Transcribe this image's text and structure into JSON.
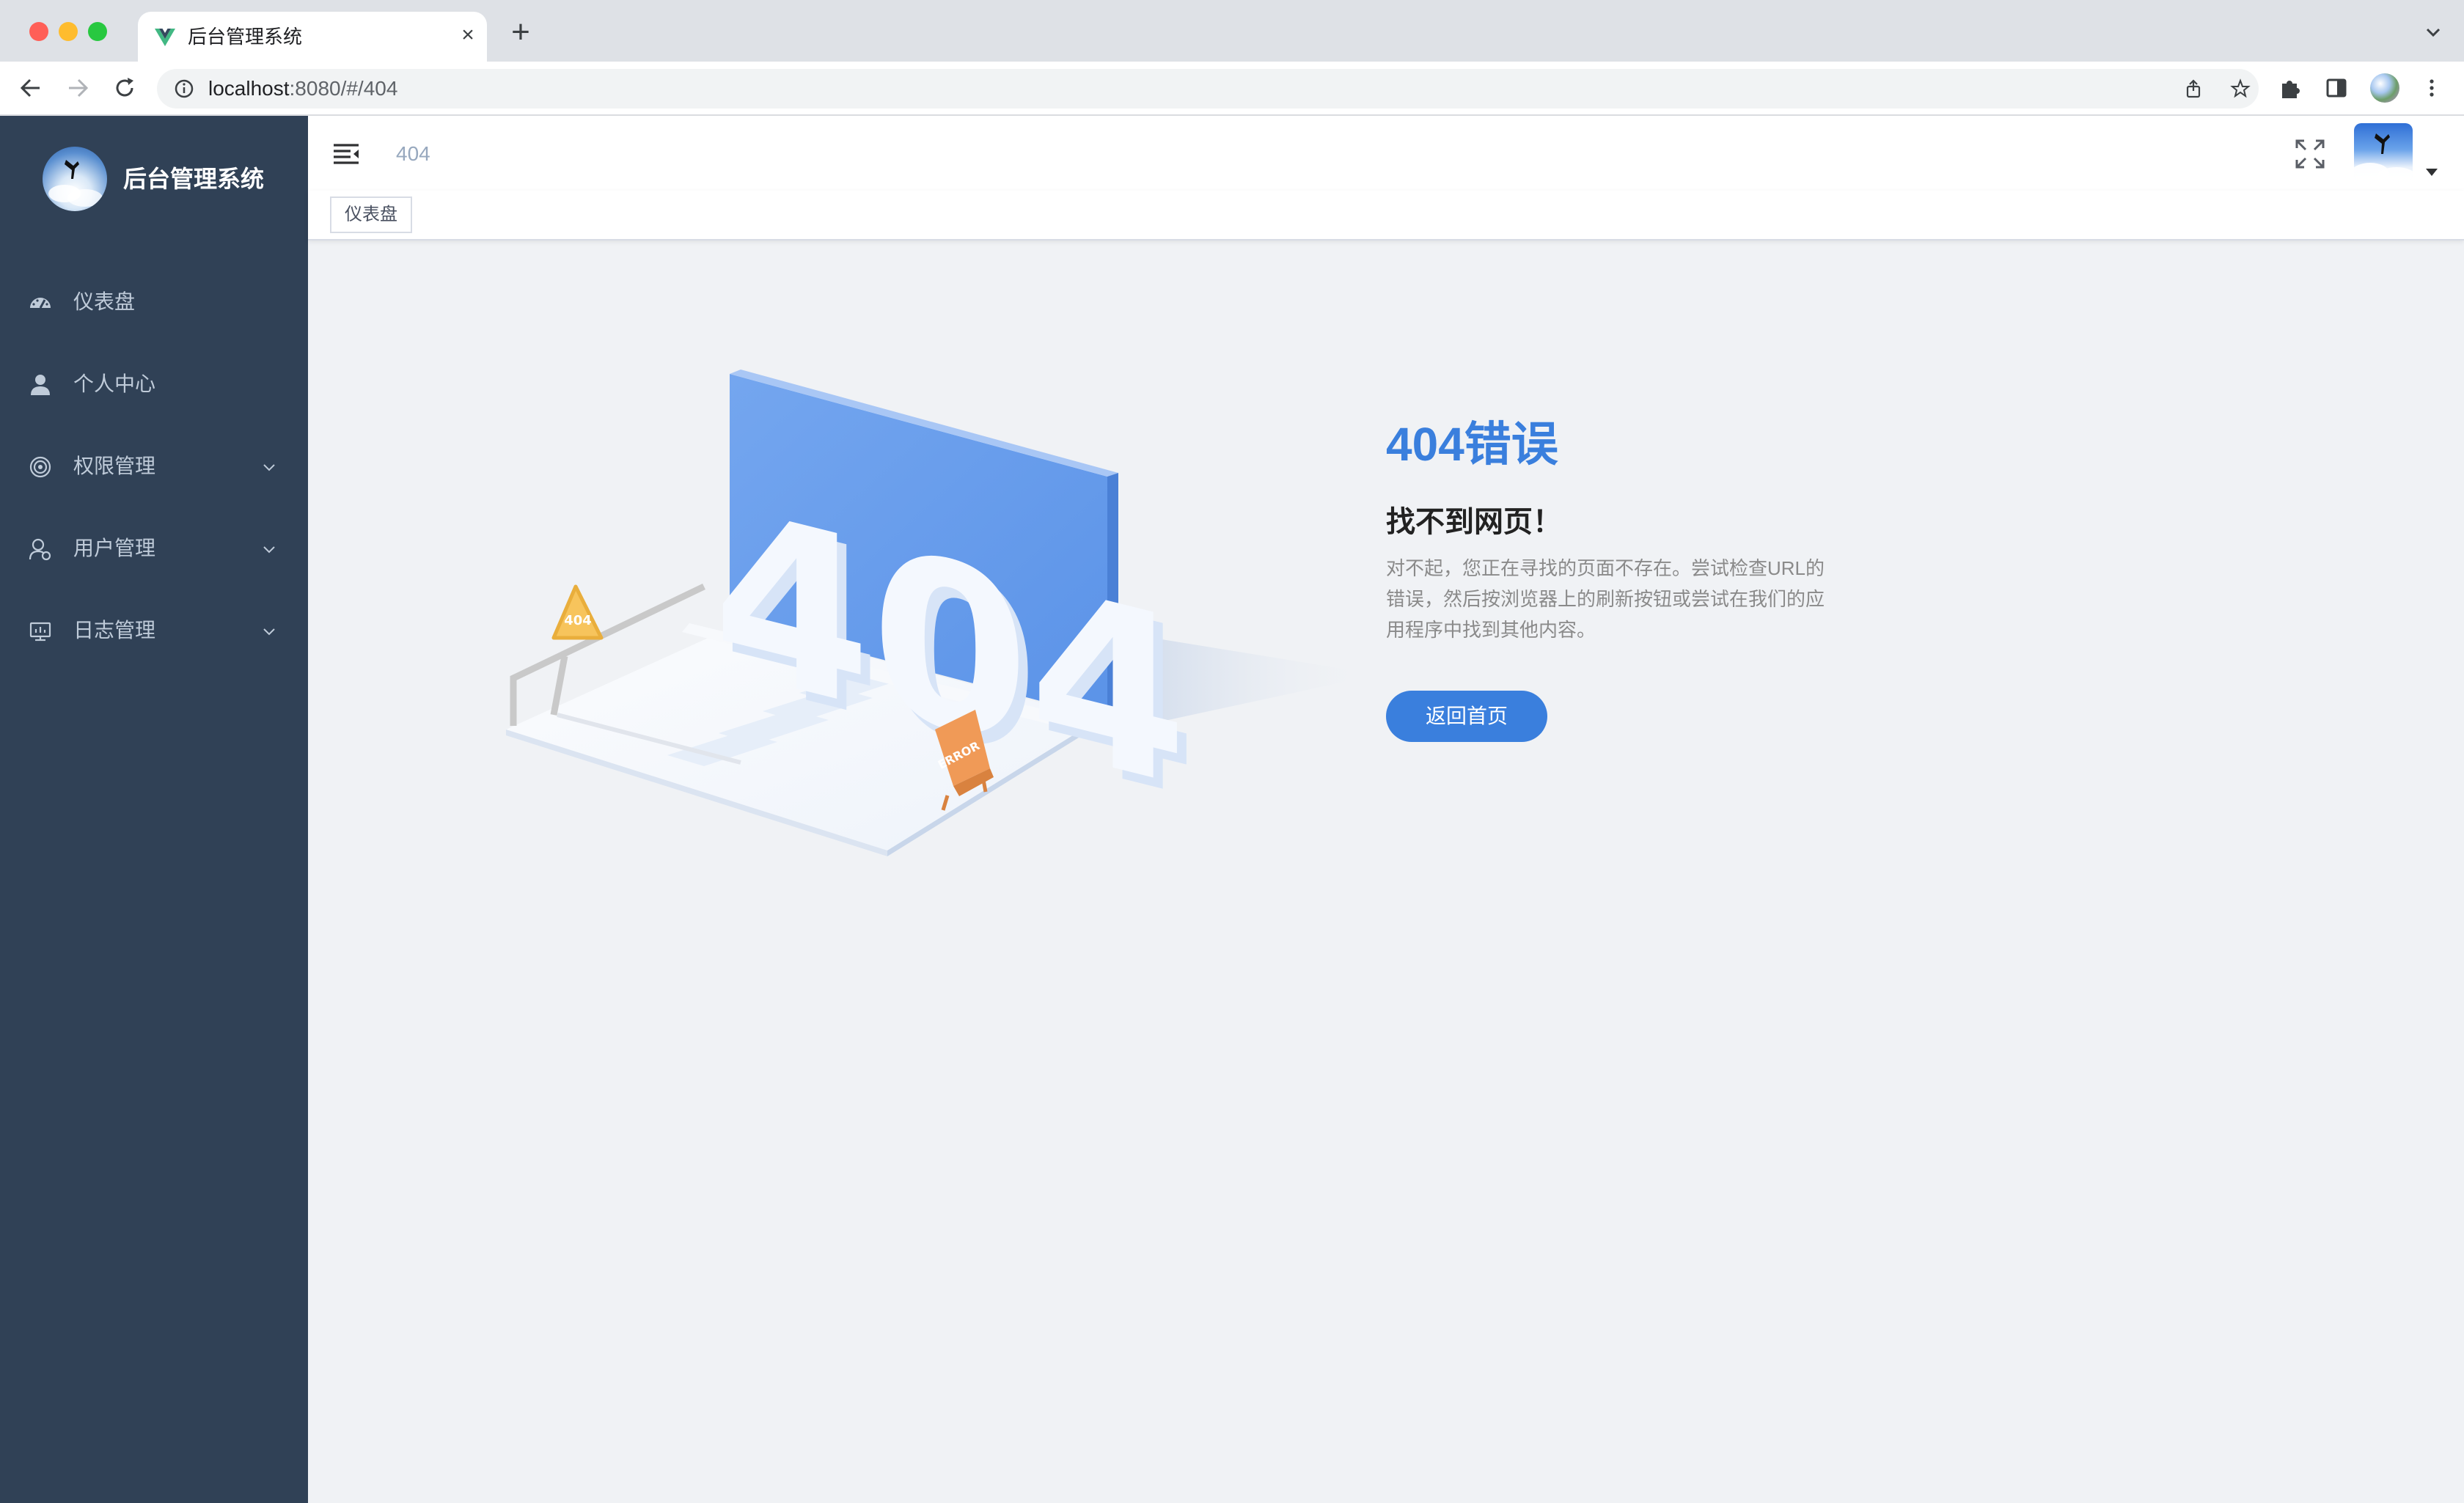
{
  "browser": {
    "tab_title": "后台管理系统",
    "tab_close": "×",
    "new_tab": "+",
    "url_host": "localhost",
    "url_path": ":8080/#/404"
  },
  "sidebar": {
    "title": "后台管理系统",
    "items": [
      {
        "label": "仪表盘",
        "icon": "dashboard-icon",
        "has_submenu": false
      },
      {
        "label": "个人中心",
        "icon": "user-icon",
        "has_submenu": false
      },
      {
        "label": "权限管理",
        "icon": "permission-icon",
        "has_submenu": true
      },
      {
        "label": "用户管理",
        "icon": "user-management-icon",
        "has_submenu": true
      },
      {
        "label": "日志管理",
        "icon": "log-icon",
        "has_submenu": true
      }
    ]
  },
  "navbar": {
    "breadcrumb": "404"
  },
  "tags": [
    {
      "label": "仪表盘"
    }
  ],
  "error_page": {
    "title": "404错误",
    "headline": "找不到网页！",
    "info": "对不起，您正在寻找的页面不存在。尝试检查URL的错误，然后按浏览器上的刷新按钮或尝试在我们的应用程序中找到其他内容。",
    "button": "返回首页",
    "illustration_text": "404",
    "sign_text": "404",
    "error_sign_text": "ERROR"
  },
  "colors": {
    "sidebar_bg": "#304156",
    "sidebar_text": "#bfcbd9",
    "accent": "#3a7fdd",
    "page_bg": "#f0f2f5"
  }
}
